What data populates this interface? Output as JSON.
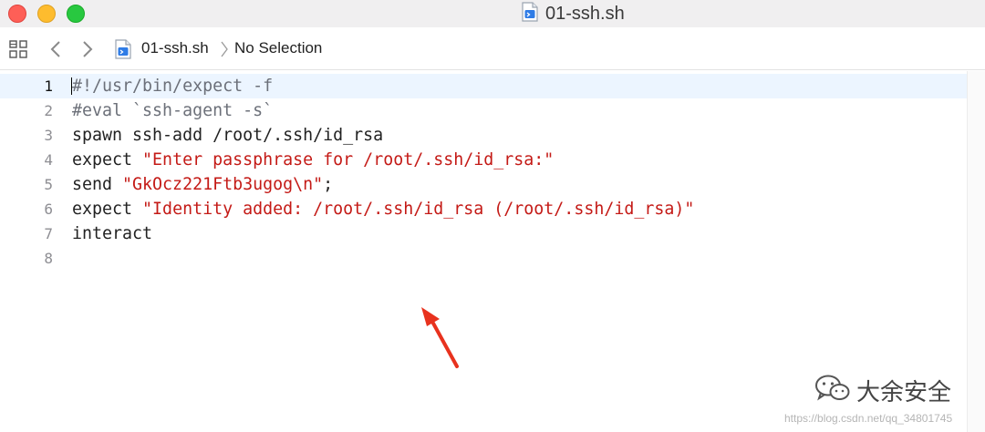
{
  "window": {
    "title": "01-ssh.sh",
    "title_icon": "shell-script-file-icon"
  },
  "jumpbar": {
    "icons": [
      "related-items-grid-icon",
      "chevron-left-icon",
      "chevron-right-icon"
    ],
    "file_name": "01-ssh.sh",
    "selection": "No Selection"
  },
  "editor": {
    "current_line": 1,
    "lines": [
      {
        "number": "1",
        "segments": [
          {
            "kind": "comment",
            "text": "#!/usr/bin/expect -f"
          }
        ]
      },
      {
        "number": "2",
        "segments": [
          {
            "kind": "comment",
            "text": "#eval `ssh-agent -s`"
          }
        ]
      },
      {
        "number": "3",
        "segments": [
          {
            "kind": "plain",
            "text": "spawn ssh-add /root/.ssh/id_rsa"
          }
        ]
      },
      {
        "number": "4",
        "segments": [
          {
            "kind": "plain",
            "text": "expect "
          },
          {
            "kind": "str",
            "text": "\"Enter passphrase for /root/.ssh/id_rsa:\""
          }
        ]
      },
      {
        "number": "5",
        "segments": [
          {
            "kind": "plain",
            "text": "send "
          },
          {
            "kind": "str",
            "text": "\"GkOcz221Ftb3ugog\\n\""
          },
          {
            "kind": "plain",
            "text": ";"
          }
        ]
      },
      {
        "number": "6",
        "segments": [
          {
            "kind": "plain",
            "text": "expect "
          },
          {
            "kind": "str",
            "text": "\"Identity added: /root/.ssh/id_rsa (/root/.ssh/id_rsa)\""
          }
        ]
      },
      {
        "number": "7",
        "segments": [
          {
            "kind": "plain",
            "text": "interact"
          }
        ]
      },
      {
        "number": "8",
        "segments": []
      }
    ]
  },
  "overlay": {
    "watermark_text": "大余安全",
    "url_text": "https://blog.csdn.net/qq_34801745"
  },
  "colors": {
    "string": "#c41a16",
    "comment": "#6c7079",
    "current_line_bg": "#ecf5ff",
    "arrow": "#e8321e"
  }
}
